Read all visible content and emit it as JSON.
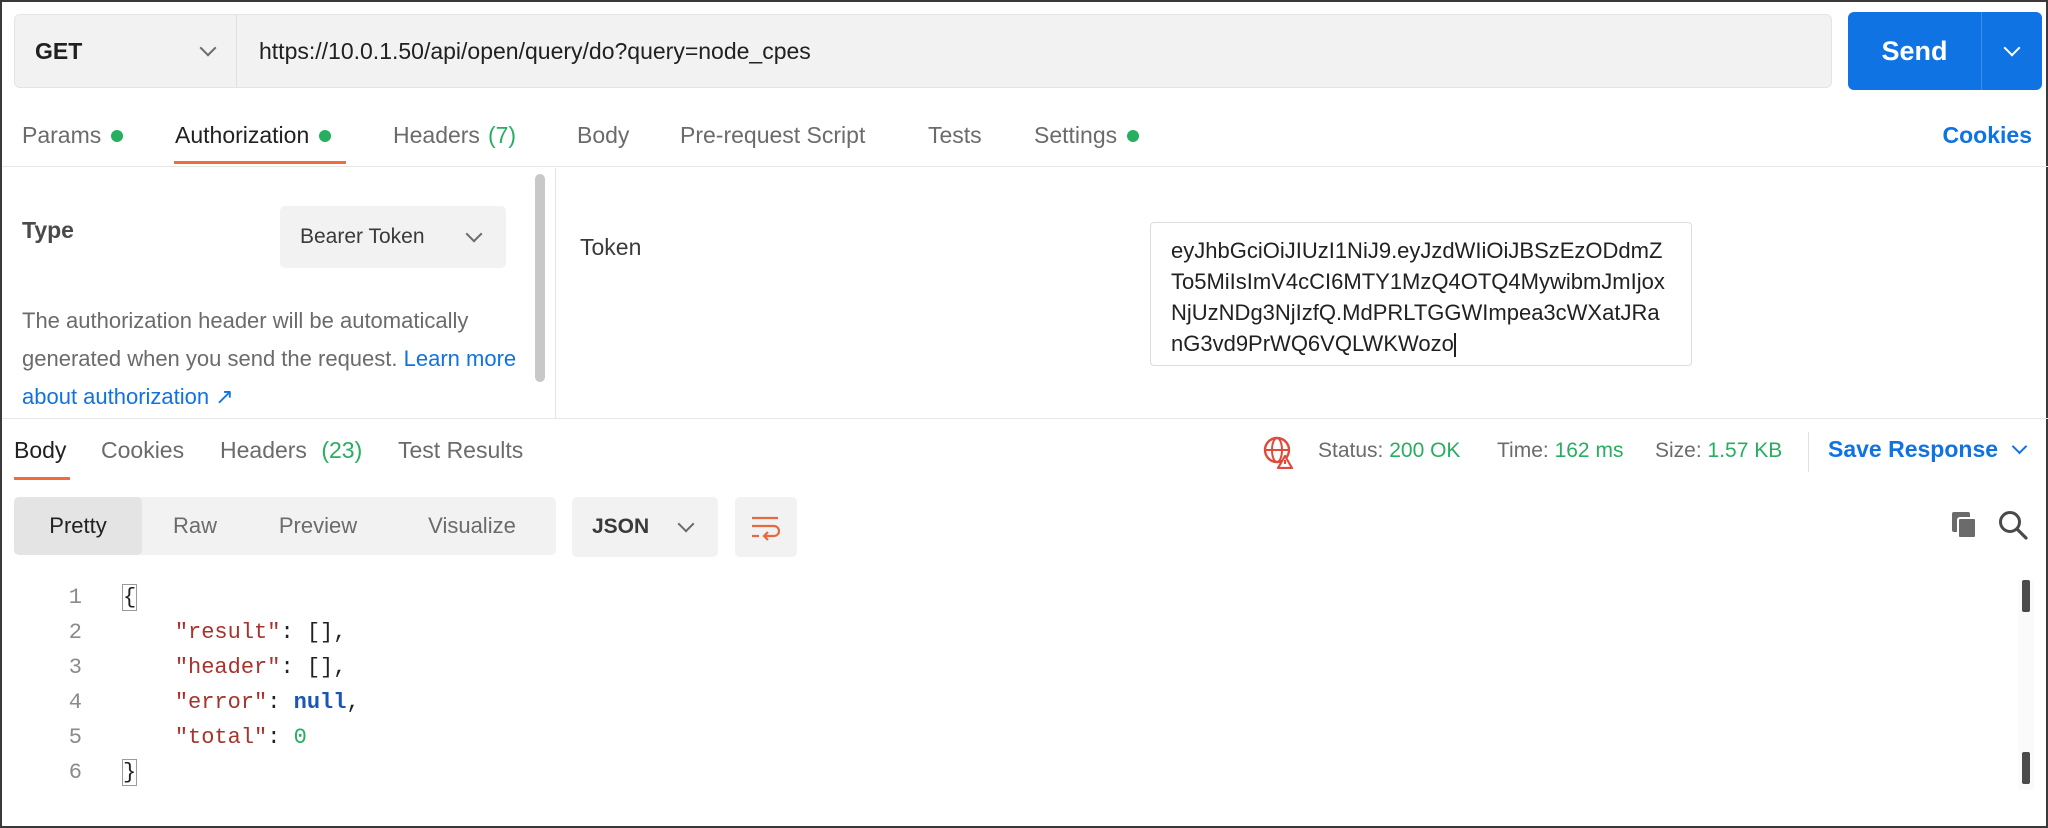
{
  "request": {
    "method": "GET",
    "url": "https://10.0.1.50/api/open/query/do?query=node_cpes",
    "send_label": "Send"
  },
  "request_tabs": [
    {
      "label": "Params",
      "dot": true,
      "active": false
    },
    {
      "label": "Authorization",
      "dot": true,
      "active": true
    },
    {
      "label": "Headers",
      "count": "(7)",
      "active": false
    },
    {
      "label": "Body",
      "active": false
    },
    {
      "label": "Pre-request Script",
      "active": false
    },
    {
      "label": "Tests",
      "active": false
    },
    {
      "label": "Settings",
      "dot": true,
      "active": false
    }
  ],
  "cookies_link": "Cookies",
  "auth": {
    "type_label": "Type",
    "type_value": "Bearer Token",
    "description": "The authorization header will be automatically generated when you send the request.",
    "learn_more": "Learn more about authorization ↗",
    "token_label": "Token",
    "token_value": "eyJhbGciOiJIUzI1NiJ9.eyJzdWIiOiJBSzEzODdmZTo5MiIsImV4cCI6MTY1MzQ4OTQ4MywibmJmIjoxNjUzNDg3NjIzfQ.MdPRLTGGWImpea3cWXatJRanG3vd9PrWQ6VQLWKWozo"
  },
  "response_tabs": [
    {
      "label": "Body",
      "active": true
    },
    {
      "label": "Cookies",
      "active": false
    },
    {
      "label": "Headers",
      "count": "(23)",
      "active": false
    },
    {
      "label": "Test Results",
      "active": false
    }
  ],
  "response_status": {
    "status_label": "Status:",
    "status_value": "200 OK",
    "time_label": "Time:",
    "time_value": "162 ms",
    "size_label": "Size:",
    "size_value": "1.57 KB",
    "save_label": "Save Response"
  },
  "view_modes": [
    {
      "label": "Pretty",
      "active": true
    },
    {
      "label": "Raw",
      "active": false
    },
    {
      "label": "Preview",
      "active": false
    },
    {
      "label": "Visualize",
      "active": false
    }
  ],
  "format": "JSON",
  "code_lines": [
    {
      "n": "1",
      "text": "{"
    },
    {
      "n": "2",
      "key": "\"result\"",
      "value": "[]",
      "trail": ","
    },
    {
      "n": "3",
      "key": "\"header\"",
      "value": "[]",
      "trail": ","
    },
    {
      "n": "4",
      "key": "\"error\"",
      "value": "null",
      "trail": ","
    },
    {
      "n": "5",
      "key": "\"total\"",
      "value": "0",
      "trail": ""
    },
    {
      "n": "6",
      "text": "}"
    }
  ],
  "colors": {
    "accent": "#0f73e4",
    "tab_underline": "#f26b3a",
    "success": "#27ae60",
    "json_key": "#a8322c",
    "json_keyword": "#1a56b8"
  }
}
